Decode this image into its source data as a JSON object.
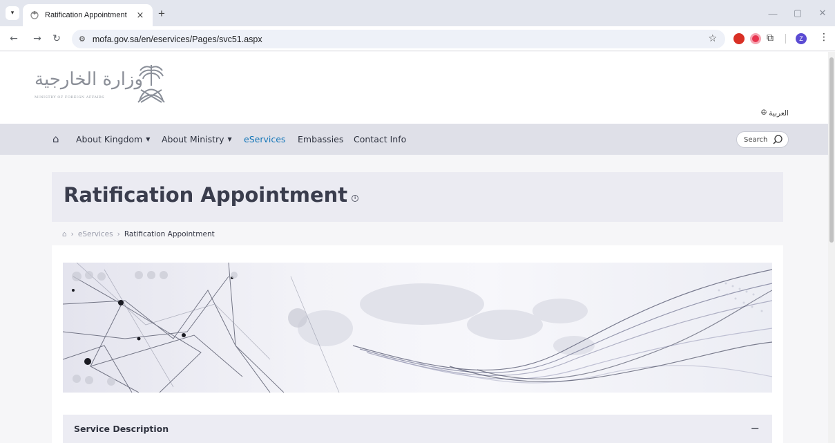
{
  "browser": {
    "tab_title": "Ratification Appointment",
    "tab_close": "×",
    "new_tab": "+",
    "url": "mofa.gov.sa/en/eservices/Pages/svc51.aspx",
    "profile_initial": "Z",
    "icons": [
      "tab-menu-icon",
      "favicon-icon",
      "back-arrow-icon",
      "forward-arrow-icon",
      "reload-icon",
      "site-info-icon",
      "star-icon",
      "extension-icon",
      "puzzle-icon",
      "kebab-menu-icon",
      "minimize-icon",
      "maximize-icon",
      "close-window-icon"
    ]
  },
  "header": {
    "logo_arabic": "وزارة الخارجية",
    "logo_english": "MINISTRY OF FOREIGN AFFAIRS",
    "language_link": "العربية"
  },
  "nav": {
    "items": [
      {
        "label": "About Kingdom",
        "has_dropdown": true
      },
      {
        "label": "About Ministry",
        "has_dropdown": true
      },
      {
        "label": "eServices",
        "active": true
      },
      {
        "label": "Embassies"
      },
      {
        "label": "Contact Info"
      }
    ],
    "search_placeholder": "Search",
    "active_color": "#1576b8"
  },
  "page": {
    "title": "Ratification Appointment",
    "breadcrumb": [
      "eServices",
      "Ratification Appointment"
    ],
    "service_description": "Service Description",
    "collapse_symbol": "−"
  }
}
